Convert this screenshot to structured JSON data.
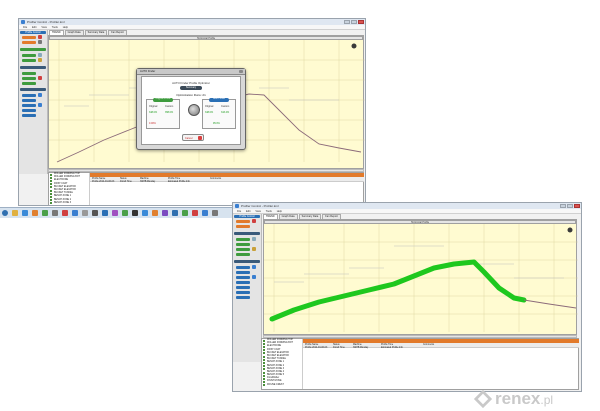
{
  "window1": {
    "title": "Profiler Control - Profiler.kml",
    "menu": [
      "File",
      "Edit",
      "View",
      "Tools",
      "Help"
    ],
    "tabs": [
      "TREND",
      "Graph Data",
      "Summary Data",
      "Fan Report"
    ],
    "chart_title": "Horizontal Profile",
    "sidebar_header": "Profile Control"
  },
  "dialog": {
    "title": "AUTO Finder",
    "subtitle": "AUTO Finder Profile Optimizer",
    "pill": "Summary",
    "optimization": "Optimization Runs: 21",
    "left_header": "Original Profile",
    "right_header": "Best Profile",
    "left": {
      "l1": "Original",
      "l2": "Custom",
      "v1": "348.0%",
      "v2": "358.0%",
      "v3": "0.00%"
    },
    "right": {
      "l1": "Original",
      "l2": "Custom",
      "v1": "348.0%",
      "v2": "343.4%",
      "v3": "95.0%"
    },
    "button": "Cancel"
  },
  "window2": {
    "title": "Profiler Control - Profiler.kml",
    "tabs": [
      "TREND",
      "Graph Data",
      "Summary Data",
      "Fan Report"
    ],
    "chart_title": "Horizontal Profile",
    "sidebar_header": "Profile Control"
  },
  "objects": [
    "ROLLER FORMING TOP",
    "ROLLER FORMING BOT",
    "ELECTRODE",
    "FIRST COAT",
    "BUCKET ELEVATOR",
    "BUCKET ELEVATOR",
    "BUCKET TUNNEL",
    "BENCH ZONE 1",
    "BENCH ZONE 2",
    "BENCH ZONE 3",
    "BENCH ZONE 4",
    "BENCH ZONE 5",
    "FinishRoller",
    "FINISH ZONE",
    "MOUSE CREST"
  ],
  "grid": {
    "columns": [
      "Profile Name",
      "Status",
      "Machine",
      "Profile Time",
      "Comments"
    ],
    "row": [
      "Profile 2014-04-06-03",
      "Finish Time",
      "NSHB Monday",
      "Estimated Profile Info",
      ""
    ]
  },
  "watermark": {
    "brand": "renex",
    "suffix": ".pl"
  },
  "colors": {
    "chart_bg": "#fffbd1",
    "profile_line": "#8c6b7a",
    "highlight": "#1ec81e",
    "accent_orange": "#e27a2b",
    "sidebar_green": "#3e9b3e",
    "sidebar_blue": "#2a6fb5",
    "sidebar_red": "#d04040"
  }
}
